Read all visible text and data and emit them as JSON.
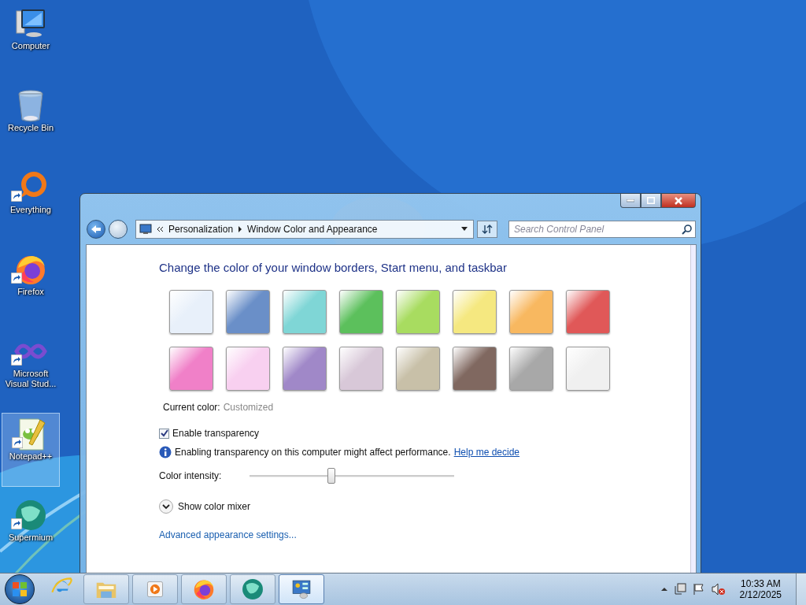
{
  "desktop_icons": [
    {
      "kind": "computer",
      "label": "Computer",
      "shortcut": false,
      "selected": false
    },
    {
      "kind": "recycle-bin",
      "label": "Recycle Bin",
      "shortcut": false,
      "selected": false
    },
    {
      "kind": "ring",
      "label": "Everything",
      "shortcut": true,
      "selected": false
    },
    {
      "kind": "fox",
      "label": "Firefox",
      "shortcut": true,
      "selected": false
    },
    {
      "kind": "infinity",
      "label": "Microsoft Visual Stud...",
      "shortcut": true,
      "selected": false
    },
    {
      "kind": "notepad",
      "label": "Notepad++",
      "shortcut": true,
      "selected": true
    },
    {
      "kind": "globe",
      "label": "Supermium",
      "shortcut": true,
      "selected": false
    }
  ],
  "window": {
    "breadcrumbs": [
      "Personalization",
      "Window Color and Appearance"
    ],
    "search": {
      "placeholder": "Search Control Panel"
    },
    "heading": "Change the color of your window borders, Start menu, and taskbar",
    "swatches": [
      {
        "color": "#e8f0fa"
      },
      {
        "color": "#6a8fc8"
      },
      {
        "color": "#7fd6d6"
      },
      {
        "color": "#5cc05c"
      },
      {
        "color": "#a8dc60"
      },
      {
        "color": "#f5e880"
      },
      {
        "color": "#f8b860"
      },
      {
        "color": "#e05858"
      },
      {
        "color": "#f080c8"
      },
      {
        "color": "#f8d0f0"
      },
      {
        "color": "#a088c8"
      },
      {
        "color": "#d8c8d8"
      },
      {
        "color": "#c8c0a8"
      },
      {
        "color": "#806860"
      },
      {
        "color": "#a8a8a8"
      },
      {
        "color": "#f0f0f0"
      }
    ],
    "current_color": {
      "label": "Current color:",
      "value": "Customized"
    },
    "transparency": {
      "label": "Enable transparency",
      "checked": true
    },
    "info": {
      "text": "Enabling transparency on this computer might affect performance.",
      "link": "Help me decide"
    },
    "intensity": {
      "label": "Color intensity:",
      "level": 0.4
    },
    "mixer": {
      "label": "Show color mixer",
      "expanded": false
    },
    "advanced_link": "Advanced appearance settings..."
  },
  "taskbar": {
    "quick_launch": [
      {
        "kind": "browser-e"
      }
    ],
    "buttons": [
      {
        "kind": "folder",
        "selected": false
      },
      {
        "kind": "media",
        "selected": false
      },
      {
        "kind": "fox",
        "selected": false
      },
      {
        "kind": "globe",
        "selected": false
      },
      {
        "kind": "control-panel",
        "selected": true
      }
    ],
    "time": "10:33 AM",
    "date": "2/12/2025"
  }
}
